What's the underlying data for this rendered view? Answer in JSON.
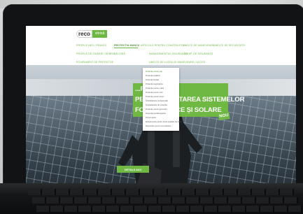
{
  "site": {
    "logo_main": "reco",
    "logo_sub": "vitrină"
  },
  "nav": {
    "row1": [
      "PROFILE NEO / PEMICO",
      "PROTECȚIA MUNCII",
      "ARTICOLE PENTRU CONSTRUCȚII",
      "UNELTE DE MANEVRARE",
      "UNELTE DE SECURITATE"
    ],
    "row2": [
      "PROFILE DE ZIDĂRIE / DEBRIS",
      "DECORĂ",
      "MANAGEMENTUL SIGURANȚEI",
      "ECHIP. DE SIGURANȚĂ"
    ],
    "row3": [
      "ECHIPAMENT DE PROTECȚIE",
      "UNELTE DE LUCRU ȘI MANEVRARE / ACCES"
    ],
    "active": "PROTECȚIA MUNCII"
  },
  "dropdown": {
    "items": [
      "Protecția pentru cap",
      "Protecția auditivă",
      "Protecție faciala",
      "Protecția respiratorie",
      "Protecția pentru mâini",
      "Protecția pentru ochi",
      "Protecția pentru picior",
      "Îmbrăcăminte profesională",
      "Îmbrăcăminte de protecție",
      "Protecție pentru genunchi",
      "Prevenție antiderapantă",
      "Primul ajutor",
      "Echipamente pentru ținuta spațiilor de lucru",
      "Dispozitive pentru semnalizare"
    ],
    "highlighted_index": 0
  },
  "hero": {
    "title_lines": [
      "...RUBURI",
      "PENTRU MONTAREA SISTEMELOR",
      "FOTOVOLTAICE ȘI SOLARE"
    ],
    "badge": "NOU",
    "cta": "DETALII AICI",
    "prev_arrow": "‹",
    "next_arrow": "›"
  },
  "colors": {
    "brand_green": "#6fb843",
    "dark_green": "#4a8f2a"
  }
}
